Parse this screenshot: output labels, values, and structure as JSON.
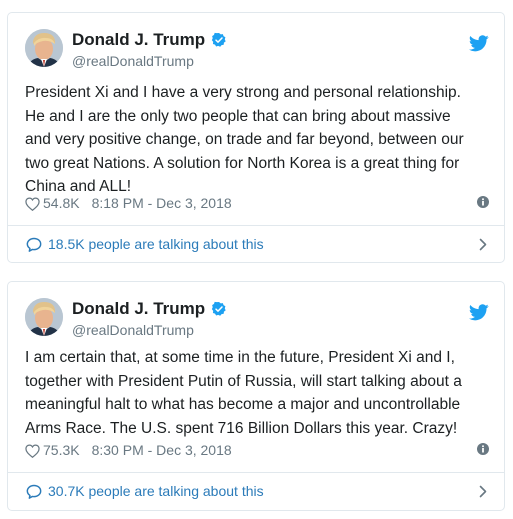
{
  "colors": {
    "text": "#1c2022",
    "secondary": "#697882",
    "link": "#2b7bb9",
    "verified": "#1da1f2",
    "border": "#e1e8ed"
  },
  "tweets": [
    {
      "display_name": "Donald J. Trump",
      "handle": "@realDonaldTrump",
      "verified": true,
      "avatar_icon": "profile-photo",
      "brand_icon": "twitter-bird-icon",
      "text_lines": [
        "President Xi and I have a very strong and personal relationship.",
        "He and I are the only two people that can bring about massive",
        "and very positive change, on trade and far beyond, between our",
        "two great Nations. A solution for North Korea is a great thing for",
        "China and ALL!"
      ],
      "likes": "54.8K",
      "timestamp": "8:18 PM - Dec 3, 2018",
      "talking": "18.5K people are talking about this"
    },
    {
      "display_name": "Donald J. Trump",
      "handle": "@realDonaldTrump",
      "verified": true,
      "avatar_icon": "profile-photo",
      "brand_icon": "twitter-bird-icon",
      "text_lines": [
        "I am certain that, at some time in the future, President Xi and I,",
        "together with President Putin of Russia, will start talking about a",
        "meaningful halt to what has become a major and uncontrollable",
        "Arms Race. The U.S. spent 716 Billion Dollars this year. Crazy!"
      ],
      "likes": "75.3K",
      "timestamp": "8:30 PM - Dec 3, 2018",
      "talking": "30.7K people are talking about this"
    }
  ]
}
